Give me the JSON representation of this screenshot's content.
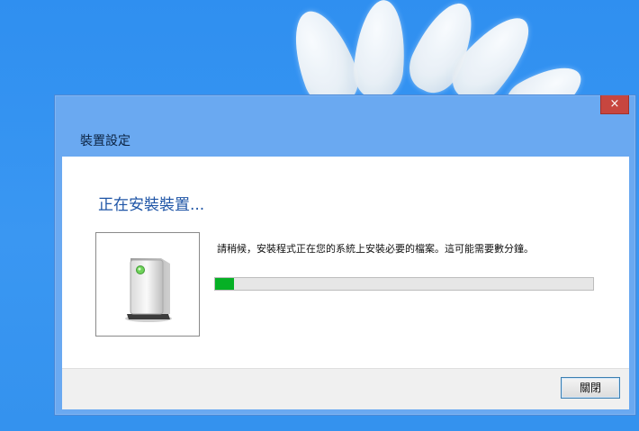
{
  "dialog": {
    "title": "裝置設定",
    "close_glyph": "×",
    "heading": "正在安裝裝置...",
    "message": "請稍候，安裝程式正在您的系統上安裝必要的檔案。這可能需要數分鐘。",
    "progress_fraction": 0.05,
    "close_button_label": "關閉",
    "progress_color": "#06b025",
    "device_icon": "device-icon"
  }
}
